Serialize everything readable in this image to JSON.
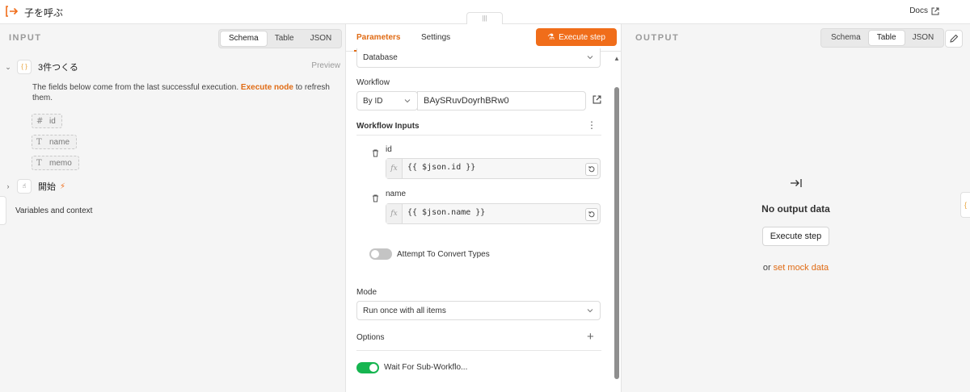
{
  "header": {
    "title": "子を呼ぶ",
    "docs_label": "Docs",
    "drag_handle": "|||"
  },
  "input": {
    "section_label": "INPUT",
    "view_tabs": [
      "Schema",
      "Table",
      "JSON"
    ],
    "active_view": "Schema",
    "node1": {
      "name": "3件つくる",
      "icon": "braces-icon",
      "preview_label": "Preview"
    },
    "info": {
      "prefix": "The fields below come from the last successful execution.",
      "link": "Execute node",
      "suffix": "to refresh them."
    },
    "fields": [
      {
        "type_glyph": "#",
        "name": "id"
      },
      {
        "type_glyph": "T",
        "name": "name"
      },
      {
        "type_glyph": "T",
        "name": "memo"
      }
    ],
    "node2": {
      "name": "開始",
      "icon": "pointer-icon",
      "badge": "lightning-icon"
    },
    "variables_label": "Variables and context"
  },
  "parameters": {
    "tabs": [
      "Parameters",
      "Settings"
    ],
    "active_tab": "Parameters",
    "execute_label": "Execute step",
    "source_value": "Database",
    "workflow_label": "Workflow",
    "workflow_mode": "By ID",
    "workflow_id": "BAySRuvDoyrhBRw0",
    "inputs_label": "Workflow Inputs",
    "inputs": [
      {
        "name": "id",
        "fx": "fx",
        "expression": "{{ $json.id }}"
      },
      {
        "name": "name",
        "fx": "fx",
        "expression": "{{ $json.name }}"
      }
    ],
    "convert_types_label": "Attempt To Convert Types",
    "convert_types_on": false,
    "mode_label": "Mode",
    "mode_value": "Run once with all items",
    "options_label": "Options",
    "wait_label": "Wait For Sub-Workflo...",
    "wait_on": true,
    "colors": {
      "accent": "#f06d1a",
      "toggle_on": "#16b550",
      "toggle_off": "#c4c4c4"
    }
  },
  "output": {
    "section_label": "OUTPUT",
    "view_tabs": [
      "Schema",
      "Table",
      "JSON"
    ],
    "active_view": "Table",
    "empty_title": "No output data",
    "execute_label": "Execute step",
    "or_text": "or",
    "mock_link": "set mock data"
  }
}
